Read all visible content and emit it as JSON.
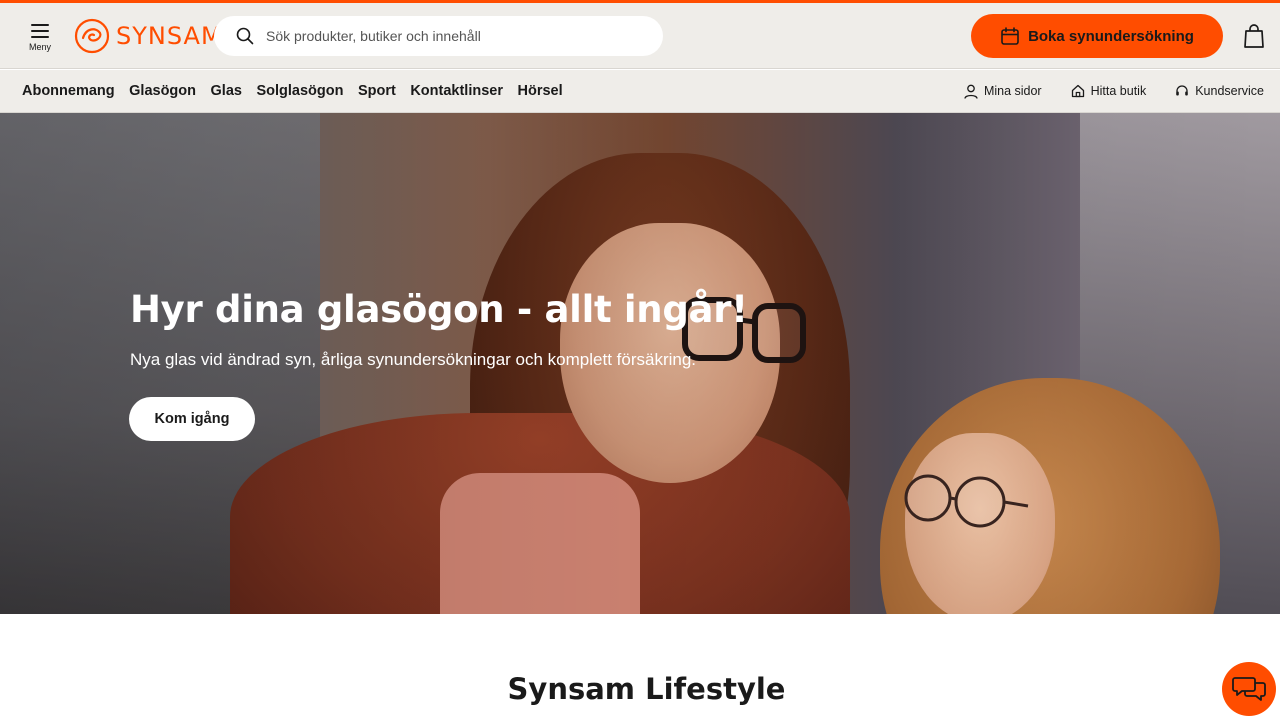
{
  "colors": {
    "brand": "#ff4d00",
    "header_bg": "#efede9"
  },
  "header": {
    "menu_label": "Meny",
    "logo_text": "SYNSAM",
    "search_placeholder": "Sök produkter, butiker och innehåll",
    "book_button": "Boka synundersökning"
  },
  "nav": {
    "main": [
      {
        "label": "Abonnemang"
      },
      {
        "label": "Glasögon"
      },
      {
        "label": "Glas"
      },
      {
        "label": "Solglasögon"
      },
      {
        "label": "Sport"
      },
      {
        "label": "Kontaktlinser"
      },
      {
        "label": "Hörsel"
      }
    ],
    "utility": [
      {
        "label": "Mina sidor",
        "icon": "user-icon"
      },
      {
        "label": "Hitta butik",
        "icon": "store-icon"
      },
      {
        "label": "Kundservice",
        "icon": "headset-icon"
      }
    ]
  },
  "hero": {
    "title": "Hyr dina glasögon - allt ingår!",
    "subtitle": "Nya glas vid ändrad syn, årliga synundersökningar och komplett försäkring.",
    "cta": "Kom igång"
  },
  "section": {
    "title": "Synsam Lifestyle"
  },
  "icons": [
    "menu-icon",
    "logo-icon",
    "search-icon",
    "calendar-icon",
    "shopping-bag-icon",
    "user-icon",
    "store-icon",
    "headset-icon",
    "chat-icon"
  ]
}
